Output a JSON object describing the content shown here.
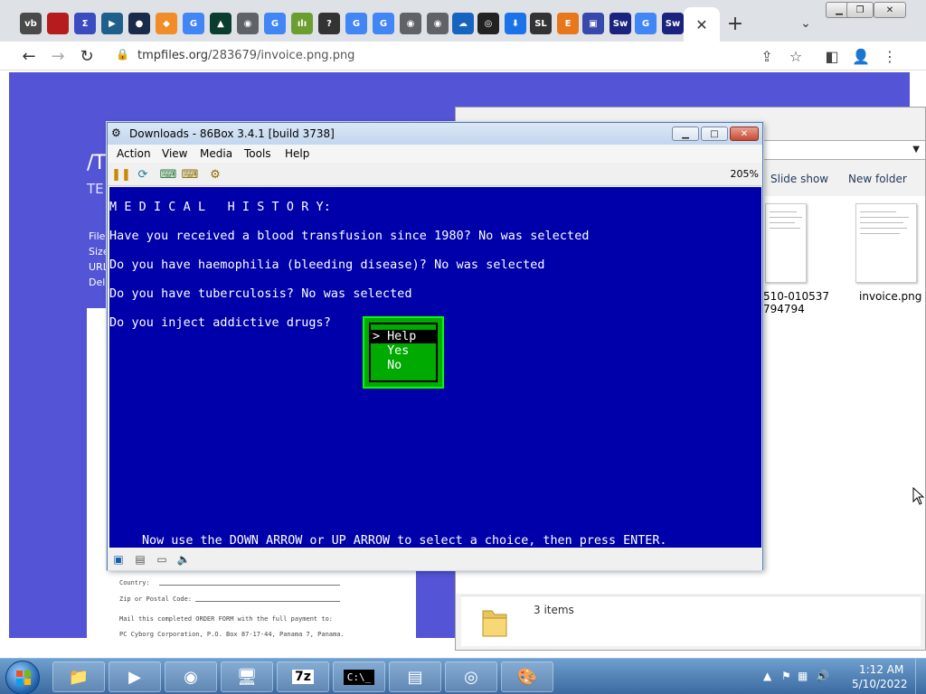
{
  "browser": {
    "tabs": [
      {
        "icon": "vb-icon",
        "label": "vb",
        "color": "#4a4a4a"
      },
      {
        "icon": "red-square-icon",
        "label": "",
        "color": "#b71c1c"
      },
      {
        "icon": "sigma-icon",
        "label": "Σ",
        "color": "#3b4cc0"
      },
      {
        "icon": "play-icon",
        "label": "▶",
        "color": "#1f5f8b"
      },
      {
        "icon": "circle-app-icon",
        "label": "●",
        "color": "#1a2a4a"
      },
      {
        "icon": "diamond-icon",
        "label": "◆",
        "color": "#f28c28"
      },
      {
        "icon": "google-icon",
        "label": "G",
        "color": "#4285f4"
      },
      {
        "icon": "triangle-icon",
        "label": "▲",
        "color": "#0b3d2e"
      },
      {
        "icon": "globe-icon",
        "label": "◉",
        "color": "#5f6368"
      },
      {
        "icon": "google-icon",
        "label": "G",
        "color": "#4285f4"
      },
      {
        "icon": "stats-icon",
        "label": "ılı",
        "color": "#6a9e2f"
      },
      {
        "icon": "question-icon",
        "label": "?",
        "color": "#333333"
      },
      {
        "icon": "google-icon",
        "label": "G",
        "color": "#4285f4"
      },
      {
        "icon": "google-icon",
        "label": "G",
        "color": "#4285f4"
      },
      {
        "icon": "globe-icon",
        "label": "◉",
        "color": "#5f6368"
      },
      {
        "icon": "globe-icon",
        "label": "◉",
        "color": "#5f6368"
      },
      {
        "icon": "cloud-upload-icon",
        "label": "☁",
        "color": "#1565c0"
      },
      {
        "icon": "github-icon",
        "label": "◎",
        "color": "#222222"
      },
      {
        "icon": "download-icon",
        "label": "⬇",
        "color": "#1a73e8"
      },
      {
        "icon": "sl-icon",
        "label": "SL",
        "color": "#333333"
      },
      {
        "icon": "e-icon",
        "label": "E",
        "color": "#e8761a"
      },
      {
        "icon": "floppy-icon",
        "label": "▣",
        "color": "#3949ab"
      },
      {
        "icon": "sw-icon",
        "label": "Sw",
        "color": "#1a237e"
      },
      {
        "icon": "google-icon",
        "label": "G",
        "color": "#4285f4"
      },
      {
        "icon": "sw-icon",
        "label": "Sw",
        "color": "#1a237e"
      }
    ],
    "active_tab_close": "✕",
    "new_tab": "+",
    "tab_search": "⌄",
    "url_host": "tmpfiles.org",
    "url_path": "/283679/invoice.png.png",
    "page": {
      "heading": "/T",
      "subheading": "TE",
      "meta_labels": [
        "File",
        "Size",
        "URL",
        "Dele"
      ],
      "doc_lines": [
        "Country:",
        "Zip or Postal Code:",
        "Mail this completed ORDER FORM with the full payment to:",
        "PC Cyborg Corporation, P.O. Box 87-17-44, Panama 7, Panama."
      ]
    }
  },
  "explorer": {
    "commands": [
      "Slide show",
      "New folder"
    ],
    "files": [
      {
        "name_line1": "510-010537",
        "name_line2": "794794"
      },
      {
        "name_line1": "invoice.png",
        "name_line2": ""
      }
    ],
    "items_count": "3 items"
  },
  "box86": {
    "title": "Downloads - 86Box 3.4.1 [build 3738]",
    "menu": [
      "Action",
      "View",
      "Media",
      "Tools",
      "Help"
    ],
    "zoom": "205%",
    "screen_lines": [
      "M E D I C A L   H I S T O R Y:",
      "Have you received a blood transfusion since 1980? No was selected",
      "Do you have haemophilia (bleeding disease)? No was selected",
      "Do you have tuberculosis? No was selected",
      "Do you inject addictive drugs?"
    ],
    "choices": [
      {
        "label": "> Help",
        "selected": true
      },
      {
        "label": "  Yes",
        "selected": false
      },
      {
        "label": "  No",
        "selected": false
      }
    ],
    "hint": "Now use the DOWN ARROW or UP ARROW to select a choice, then press ENTER."
  },
  "taskbar": {
    "time": "1:12 AM",
    "date": "5/10/2022"
  },
  "colors": {
    "dos_blue": "#0000aa",
    "dos_green": "#00aa00",
    "page_blue": "#5454d6"
  }
}
